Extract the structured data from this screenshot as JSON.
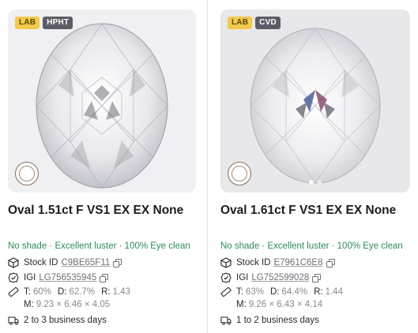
{
  "cards": [
    {
      "tags": {
        "lab": "LAB",
        "tech": "HPHT"
      },
      "title": "Oval 1.51ct F VS1 EX EX None",
      "quality": "No shade · Excellent luster · 100% Eye clean",
      "stock": {
        "label": "Stock ID",
        "value": "C9BE65F11"
      },
      "igi": {
        "label": "IGI",
        "value": "LG756535945"
      },
      "table": {
        "t_label": "T:",
        "t": "60%",
        "d_label": "D:",
        "d": "62.7%",
        "r_label": "R:",
        "r": "1.43"
      },
      "measure": {
        "label": "M:",
        "value": "9.23 × 6.46 × 4.05"
      },
      "shipping": "2 to 3 business days"
    },
    {
      "tags": {
        "lab": "LAB",
        "tech": "CVD"
      },
      "title": "Oval 1.61ct F VS1 EX EX None",
      "quality": "No shade · Excellent luster · 100% Eye clean",
      "stock": {
        "label": "Stock ID",
        "value": "E7961C6E8"
      },
      "igi": {
        "label": "IGI",
        "value": "LG752599028"
      },
      "table": {
        "t_label": "T:",
        "t": "63%",
        "d_label": "D:",
        "d": "64.4%",
        "r_label": "R:",
        "r": "1.44"
      },
      "measure": {
        "label": "M:",
        "value": "9.26 × 6.43 × 4.14"
      },
      "shipping": "1 to 2 business days"
    }
  ],
  "colors": {
    "quality_green": "#2e8b57",
    "lab_tag": "#f2c94c",
    "tech_tag": "#5c5c66"
  },
  "icons": [
    "box-icon",
    "certificate-check-icon",
    "ruler-icon",
    "truck-icon",
    "copy-icon",
    "igi-seal-icon"
  ]
}
